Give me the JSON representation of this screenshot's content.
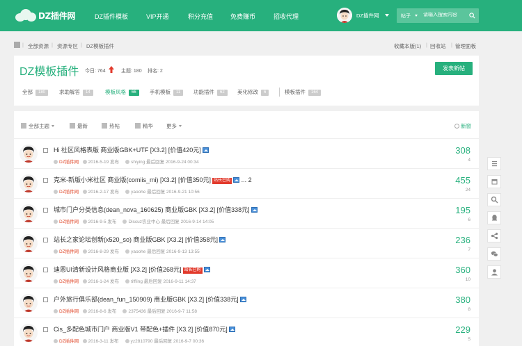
{
  "header": {
    "logo_text": "DZ插件网",
    "nav": [
      "DZ插件模板",
      "VIP开通",
      "积分充值",
      "免费赚币",
      "招收代理"
    ],
    "user_name": "DZ插件网",
    "search_type": "帖子",
    "search_placeholder": "请输入搜索内容"
  },
  "breadcrumb": {
    "items": [
      "全部资源",
      "资源专区",
      "DZ模板插件"
    ],
    "right": [
      "收藏本版",
      "回收站",
      "管理面板"
    ],
    "fav_count": "1"
  },
  "forum": {
    "title": "DZ模板插件",
    "today_label": "今日:",
    "today": "764",
    "topics_label": "主题:",
    "topics": "180",
    "rank_label": "排名:",
    "rank": "2",
    "post_button": "发表新帖",
    "tabs": [
      {
        "label": "全部",
        "count": "180"
      },
      {
        "label": "求助解答",
        "count": "14"
      },
      {
        "label": "模板风格",
        "count": "66"
      },
      {
        "label": "手机模板",
        "count": "11"
      },
      {
        "label": "功能插件",
        "count": "62"
      },
      {
        "label": "美化修改",
        "count": "6"
      },
      {
        "label": "模板插件",
        "count": "164"
      }
    ],
    "active_tab": "模板风格"
  },
  "filters": {
    "items": [
      "全部主题",
      "最新",
      "热帖",
      "精华",
      "更多"
    ],
    "newest": "新窗"
  },
  "threads": [
    {
      "title": "Hi 社区风格表版 商业版GBK+UTF [X3.2] [价值420元]",
      "badge": "",
      "extra": "",
      "author": "DZ插件网",
      "date": "2016-5-19 发布",
      "last_user": "shiying",
      "last_label": "最后回复",
      "last_time": "2016-9-24 00:34",
      "views": "308",
      "replies": "4"
    },
    {
      "title": "克米-新版小米社区 商业版(comiis_mi) [X3.2] [价值350元]",
      "badge": "站长已购",
      "extra": "... 2",
      "author": "DZ插件网",
      "date": "2016-2-17 发布",
      "last_user": "yaoohe",
      "last_label": "最后回复",
      "last_time": "2016-9-21 10:56",
      "views": "455",
      "replies": "24"
    },
    {
      "title": "城市门户分类信息(dean_nova_160625) 商业版GBK [X3.2] [价值338元]",
      "badge": "",
      "extra": "",
      "author": "DZ插件网",
      "date": "2016-9-5 发布",
      "last_user": "Discuz农业中心",
      "last_label": "最后回复",
      "last_time": "2016-9-14 14:05",
      "views": "195",
      "replies": "6"
    },
    {
      "title": "站长之家论坛创新(x520_so) 商业版GBK [X3.2] [价值358元]",
      "badge": "",
      "extra": "",
      "author": "DZ插件网",
      "date": "2016-8-29 发布",
      "last_user": "yaoohe",
      "last_label": "最后回复",
      "last_time": "2016-9-13 13:55",
      "views": "236",
      "replies": "7"
    },
    {
      "title": "迪恩UI清新设计风格商业版 [X3.2] [价值268元]",
      "badge": "站长已购",
      "extra": "",
      "author": "DZ插件网",
      "date": "2016-1-24 发布",
      "last_user": "tiffling",
      "last_label": "最后回复",
      "last_time": "2016-9-11 14:37",
      "views": "360",
      "replies": "10"
    },
    {
      "title": "户外旅行俱乐部(dean_fun_150909) 商业版GBK [X3.2] [价值338元]",
      "badge": "",
      "extra": "",
      "author": "DZ插件网",
      "date": "2016-8-6 发布",
      "last_user": "2375436",
      "last_label": "最后回复",
      "last_time": "2016-9-7 11:58",
      "views": "380",
      "replies": "8"
    },
    {
      "title": "Cis_多配色城市门户 商业版V1 带配色+插件 [X3.2] [价值870元]",
      "badge": "",
      "extra": "",
      "author": "DZ插件网",
      "date": "2016-3-11 发布",
      "last_user": "yz2810790",
      "last_label": "最后回复",
      "last_time": "2016-9-7 00:36",
      "views": "229",
      "replies": "5"
    }
  ],
  "tools": [
    "list-icon",
    "calendar-icon",
    "search-icon",
    "qq-icon",
    "share-icon",
    "wechat-icon",
    "user-icon"
  ],
  "colors": {
    "brand": "#27b07d",
    "badge": "#e23a2c",
    "author": "#e04a2c"
  }
}
